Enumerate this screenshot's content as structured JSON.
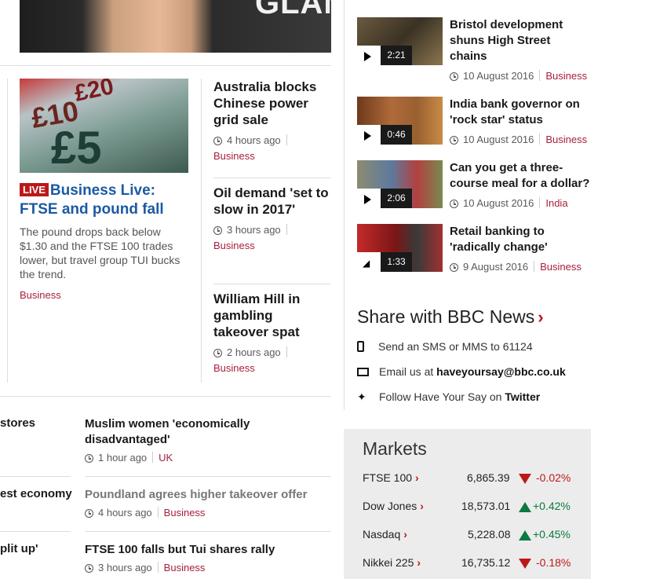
{
  "left_col": {
    "live_badge": "LIVE",
    "live_headline": "Business Live: FTSE and pound fall",
    "live_summary": "The pound drops back below $1.30 and the FTSE 100 trades lower, but travel group TUI bucks the trend.",
    "live_tag": "Business"
  },
  "mid_stories": [
    {
      "headline": "Australia blocks Chinese power grid sale",
      "time": "4 hours ago",
      "tag": "Business"
    },
    {
      "headline": "Oil demand 'set to slow in 2017'",
      "time": "3 hours ago",
      "tag": "Business"
    },
    {
      "headline": "William Hill in gambling takeover spat",
      "time": "2 hours ago",
      "tag": "Business"
    }
  ],
  "lower_cut": [
    "stores",
    "est economy",
    "plit up'"
  ],
  "lower_stories": [
    {
      "headline": "Muslim women 'economically disadvantaged'",
      "time": "1 hour ago",
      "tag": "UK"
    },
    {
      "headline": "Poundland agrees higher takeover offer",
      "time": "4 hours ago",
      "tag": "Business"
    },
    {
      "headline": "FTSE 100 falls but Tui shares rally",
      "time": "3 hours ago",
      "tag": "Business"
    }
  ],
  "videos": [
    {
      "headline": "Bristol development shuns High Street chains",
      "duration": "2:21",
      "date": "10 August 2016",
      "tag": "Business",
      "icon": "play-icon"
    },
    {
      "headline": "India bank governor on 'rock star' status",
      "duration": "0:46",
      "date": "10 August 2016",
      "tag": "Business",
      "icon": "play-icon"
    },
    {
      "headline": "Can you get a three-course meal for a dollar?",
      "duration": "2:06",
      "date": "10 August 2016",
      "tag": "India",
      "icon": "play-icon"
    },
    {
      "headline": "Retail banking to 'radically change'",
      "duration": "1:33",
      "date": "9 August 2016",
      "tag": "Business",
      "icon": "audio-icon"
    }
  ],
  "share": {
    "title": "Share with BBC News",
    "sms": "Send an SMS or MMS to 61124",
    "email_prefix": "Email us at ",
    "email": "haveyoursay@bbc.co.uk",
    "twitter_prefix": "Follow Have Your Say on ",
    "twitter": "Twitter"
  },
  "markets": {
    "title": "Markets",
    "rows": [
      {
        "name": "FTSE 100",
        "value": "6,865.39",
        "change": "-0.02%",
        "direction": "down"
      },
      {
        "name": "Dow Jones",
        "value": "18,573.01",
        "change": "+0.42%",
        "direction": "up"
      },
      {
        "name": "Nasdaq",
        "value": "5,228.08",
        "change": "+0.45%",
        "direction": "up"
      },
      {
        "name": "Nikkei 225",
        "value": "16,735.12",
        "change": "-0.18%",
        "direction": "down"
      }
    ],
    "colors": {
      "up": "#0b7a3f",
      "down": "#bb1919"
    }
  }
}
